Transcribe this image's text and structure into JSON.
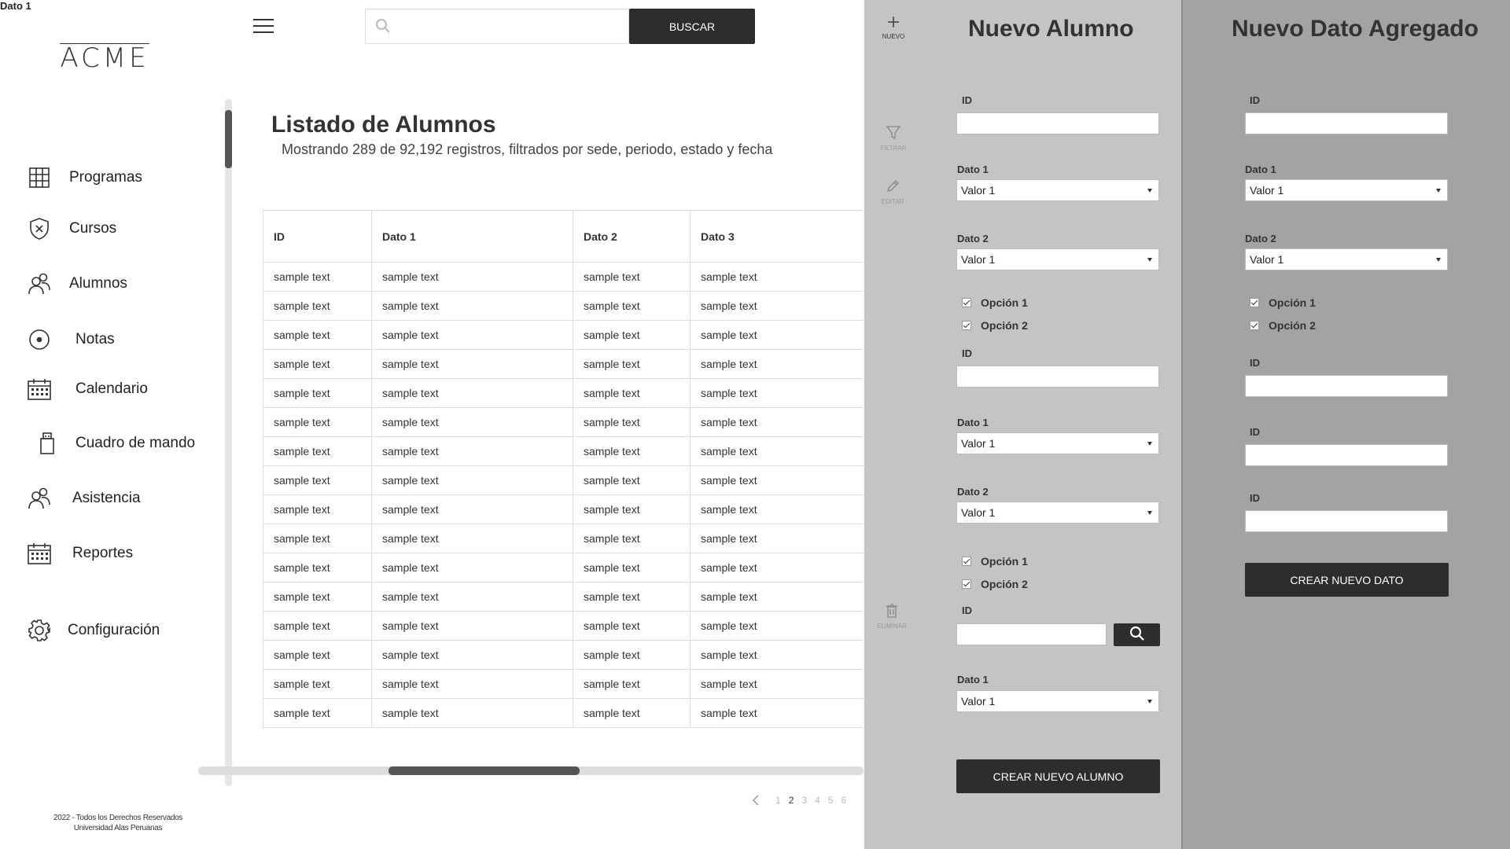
{
  "corner_label": "Dato 1",
  "logo": "ACME",
  "nav": [
    {
      "label": "Programas",
      "icon": "grid-icon"
    },
    {
      "label": "Cursos",
      "icon": "shield-icon"
    },
    {
      "label": "Alumnos",
      "icon": "users-icon"
    },
    {
      "label": "Notas",
      "icon": "disc-icon"
    },
    {
      "label": "Calendario",
      "icon": "calendar-icon"
    },
    {
      "label": "Cuadro de mando",
      "icon": "usb-icon"
    },
    {
      "label": "Asistencia",
      "icon": "users-icon"
    },
    {
      "label": "Reportes",
      "icon": "calendar-icon"
    },
    {
      "label": "Configuración",
      "icon": "gear-icon"
    }
  ],
  "footer": {
    "line1": "2022 - Todos los Derechos Reservados",
    "line2": "Universidad Alas Peruanas"
  },
  "search": {
    "placeholder": "",
    "button": "BUSCAR"
  },
  "main": {
    "title": "Listado de Alumnos",
    "subtitle": "Mostrando 289 de 92,192 registros, filtrados por sede, periodo, estado y fecha"
  },
  "table": {
    "headers": [
      "ID",
      "Dato 1",
      "Dato 2",
      "Dato 3"
    ],
    "cell": "sample text",
    "row_count": 16
  },
  "pager": {
    "pages": [
      "1",
      "2",
      "3",
      "4",
      "5",
      "6"
    ],
    "active": "2"
  },
  "tools": {
    "nuevo": "NUEVO",
    "filtrar": "FILTRAR",
    "editar": "EDITAR",
    "eliminar": "ELIMINAR"
  },
  "form_a": {
    "title": "Nuevo Alumno",
    "id_label": "ID",
    "dato1_label": "Dato 1",
    "dato2_label": "Dato 2",
    "select_value": "Valor 1",
    "opcion1": "Opción 1",
    "opcion2": "Opción 2",
    "submit": "CREAR NUEVO ALUMNO"
  },
  "form_b": {
    "title": "Nuevo Dato Agregado",
    "id_label": "ID",
    "dato1_label": "Dato 1",
    "dato2_label": "Dato 2",
    "select_value": "Valor 1",
    "opcion1": "Opción 1",
    "opcion2": "Opción 2",
    "submit": "CREAR NUEVO DATO"
  }
}
